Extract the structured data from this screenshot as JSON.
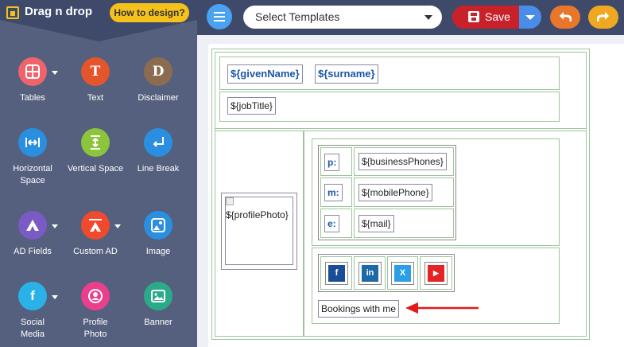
{
  "app": {
    "title": "Drag n drop",
    "how_to": "How to design?"
  },
  "tools": [
    {
      "label": "Tables",
      "icon": "table-icon",
      "color": "#f0636a",
      "glyph": ""
    },
    {
      "label": "Text",
      "icon": "text-icon",
      "color": "#e5552b",
      "glyph": "T"
    },
    {
      "label": "Disclaimer",
      "icon": "disclaimer-icon",
      "color": "#8b6c50",
      "glyph": "D"
    },
    {
      "label": "Horizontal Space",
      "icon": "horizontal-space-icon",
      "color": "#2a8fe0",
      "glyph": ""
    },
    {
      "label": "Vertical Space",
      "icon": "vertical-space-icon",
      "color": "#8cc43c",
      "glyph": ""
    },
    {
      "label": "Line Break",
      "icon": "line-break-icon",
      "color": "#2a8fe0",
      "glyph": ""
    },
    {
      "label": "AD Fields",
      "icon": "ad-fields-icon",
      "color": "#7a5ac4",
      "glyph": ""
    },
    {
      "label": "Custom AD",
      "icon": "custom-ad-icon",
      "color": "#ef4a2e",
      "glyph": ""
    },
    {
      "label": "Image",
      "icon": "image-icon",
      "color": "#2a8fe0",
      "glyph": ""
    },
    {
      "label": "Social Media",
      "icon": "social-media-icon",
      "color": "#2ab2e8",
      "glyph": "f"
    },
    {
      "label": "Profile Photo",
      "icon": "profile-photo-icon",
      "color": "#ea3f8c",
      "glyph": ""
    },
    {
      "label": "Banner",
      "icon": "banner-icon",
      "color": "#2aaa88",
      "glyph": ""
    }
  ],
  "toolbar": {
    "template_placeholder": "Select Templates",
    "save_label": "Save"
  },
  "signature": {
    "given_name": "${givenName}",
    "surname": "${surname}",
    "job_title": "${jobTitle}",
    "profile_photo": "${profilePhoto}",
    "contacts": [
      {
        "prefix": "p:",
        "value": "${businessPhones}"
      },
      {
        "prefix": "m:",
        "value": "${mobilePhone}"
      },
      {
        "prefix": "e:",
        "value": "${mail}"
      }
    ],
    "social": [
      {
        "name": "facebook-icon",
        "glyph": "f",
        "color": "#1a4d97"
      },
      {
        "name": "linkedin-icon",
        "glyph": "in",
        "color": "#1c69a8"
      },
      {
        "name": "twitter-x-icon",
        "glyph": "X",
        "color": "#2a9fe8"
      },
      {
        "name": "youtube-icon",
        "glyph": "▶",
        "color": "#e42424"
      }
    ],
    "bookings": "Bookings with me"
  }
}
